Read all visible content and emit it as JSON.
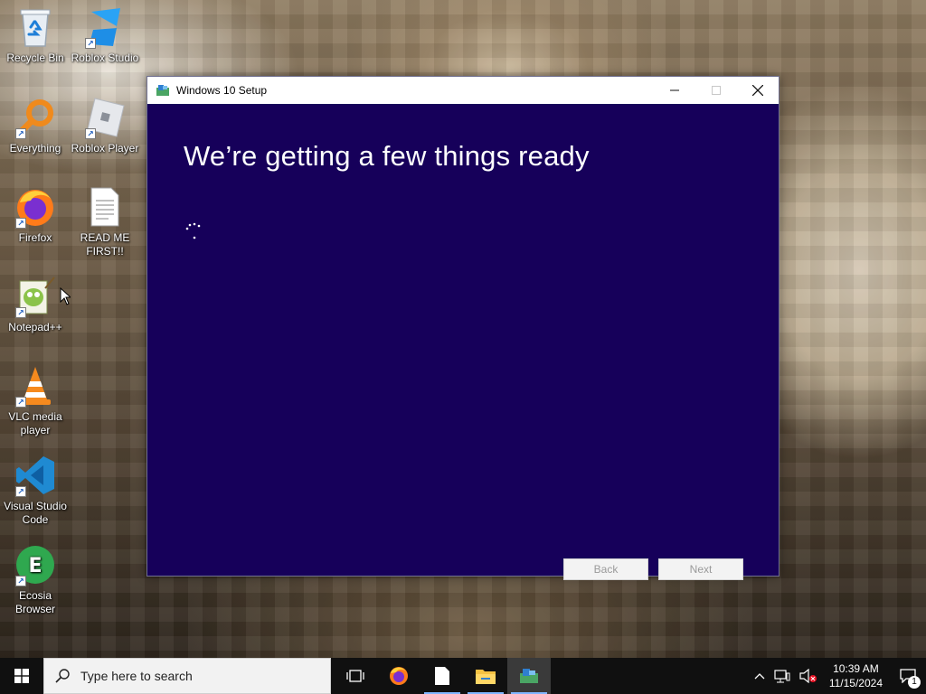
{
  "desktop": {
    "icons": [
      {
        "label": "Recycle Bin",
        "icon": "recycle-bin-icon"
      },
      {
        "label": "Roblox Studio",
        "icon": "roblox-studio-icon"
      },
      {
        "label": "Everything",
        "icon": "everything-search-icon"
      },
      {
        "label": "Roblox Player",
        "icon": "roblox-player-icon"
      },
      {
        "label": "Firefox",
        "icon": "firefox-icon"
      },
      {
        "label": "READ ME FIRST!!",
        "icon": "text-file-icon"
      },
      {
        "label": "Notepad++",
        "icon": "notepad-plus-plus-icon"
      },
      {
        "label": "VLC media player",
        "icon": "vlc-icon"
      },
      {
        "label": "Visual Studio Code",
        "icon": "vscode-icon"
      },
      {
        "label": "Ecosia Browser",
        "icon": "ecosia-icon"
      }
    ]
  },
  "setup_window": {
    "title": "Windows 10 Setup",
    "heading": "We’re getting a few things ready",
    "back_label": "Back",
    "next_label": "Next",
    "background_color": "#16005a"
  },
  "taskbar": {
    "search_placeholder": "Type here to search",
    "apps": [
      "task-view-icon",
      "firefox-icon",
      "file-icon",
      "file-explorer-icon",
      "windows-setup-icon"
    ],
    "clock_time": "10:39 AM",
    "clock_date": "11/15/2024",
    "notification_count": "1"
  }
}
